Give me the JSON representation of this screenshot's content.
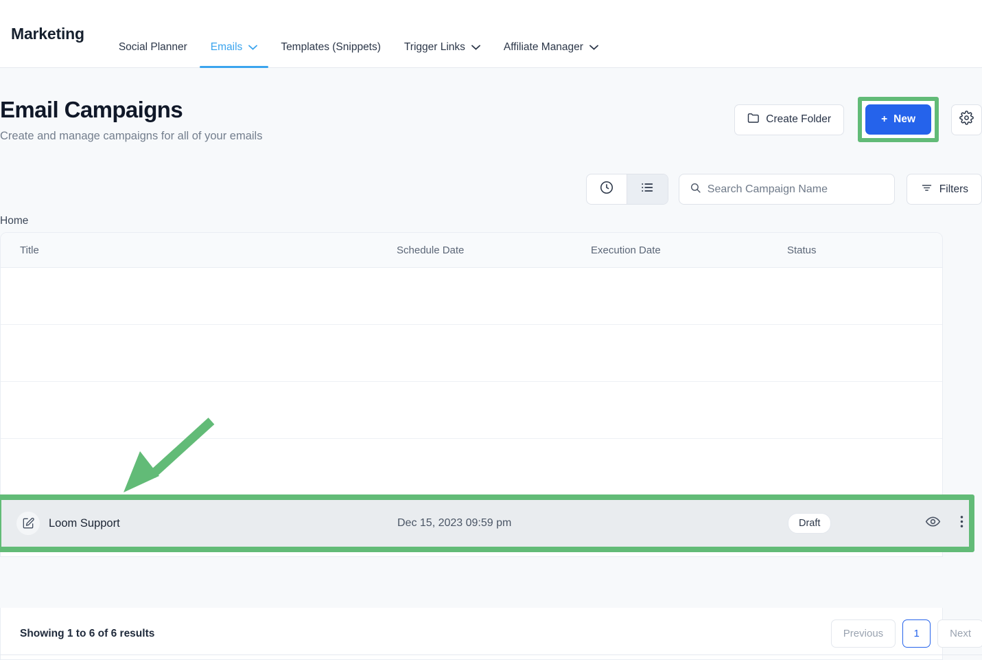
{
  "nav": {
    "brand": "Marketing",
    "items": [
      {
        "label": "Social Planner",
        "caret": "",
        "active": false
      },
      {
        "label": "Emails",
        "caret": "⌄",
        "active": true
      },
      {
        "label": "Templates (Snippets)",
        "caret": "",
        "active": false
      },
      {
        "label": "Trigger Links",
        "caret": "⌄",
        "active": false
      },
      {
        "label": "Affiliate Manager",
        "caret": "⌄",
        "active": false
      }
    ]
  },
  "header": {
    "title": "Email Campaigns",
    "subtitle": "Create and manage campaigns for all of your emails",
    "create_folder_label": "Create Folder",
    "new_label": "New",
    "new_plus": "+",
    "folder_icon": "folder-icon",
    "gear_icon": "gear-icon"
  },
  "toolbar": {
    "clock_icon": "clock-icon",
    "list_icon": "list-icon",
    "search_placeholder": "Search Campaign Name",
    "search_value": "",
    "search_icon": "search-icon",
    "filters_label": "Filters",
    "filters_icon": "filter-icon"
  },
  "breadcrumb": {
    "label": "Home"
  },
  "table": {
    "columns": [
      "Title",
      "Schedule Date",
      "Execution Date",
      "Status"
    ],
    "empty_row_count": 4,
    "rows": [
      {
        "title": "Loom Support",
        "schedule_date": "Dec 15, 2023 09:59 pm",
        "execution_date": "",
        "status": "Draft",
        "edit_icon": "edit-square-icon",
        "preview_icon": "eye-icon",
        "menu_icon": "kebab-menu-icon",
        "highlighted": true
      }
    ]
  },
  "footer": {
    "showing": "Showing 1 to 6 of 6 results",
    "previous_label": "Previous",
    "current_page": "1",
    "next_label": "Next"
  },
  "annotations": {
    "highlight_color": "#62bb77",
    "arrow_name": "green-annotation-arrow",
    "new_button_highlight": true,
    "row_highlight": true
  },
  "colors": {
    "accent_blue": "#2563eb",
    "nav_active_blue": "#3aa4ee",
    "highlight_green": "#62bb77",
    "page_bg": "#f7f9fb"
  }
}
